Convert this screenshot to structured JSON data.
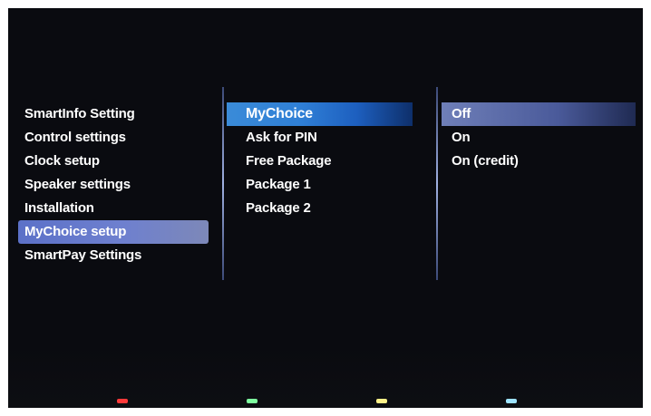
{
  "menu": {
    "categories": [
      {
        "label": "SmartInfo Setting",
        "selected": false
      },
      {
        "label": "Control settings",
        "selected": false
      },
      {
        "label": "Clock setup",
        "selected": false
      },
      {
        "label": "Speaker settings",
        "selected": false
      },
      {
        "label": "Installation",
        "selected": false
      },
      {
        "label": "MyChoice setup",
        "selected": true
      },
      {
        "label": "SmartPay Settings",
        "selected": false
      }
    ],
    "submenu": [
      {
        "label": "MyChoice",
        "selected": true
      },
      {
        "label": "Ask for PIN",
        "selected": false
      },
      {
        "label": "Free Package",
        "selected": false
      },
      {
        "label": "Package 1",
        "selected": false
      },
      {
        "label": "Package 2",
        "selected": false
      }
    ],
    "options": [
      {
        "label": "Off",
        "selected": true
      },
      {
        "label": "On",
        "selected": false
      },
      {
        "label": "On (credit)",
        "selected": false
      }
    ]
  },
  "color_keys": [
    {
      "name": "red",
      "color": "#ff3a3a"
    },
    {
      "name": "green",
      "color": "#7fffa0"
    },
    {
      "name": "yellow",
      "color": "#fff28a"
    },
    {
      "name": "blue",
      "color": "#9ee3ff"
    }
  ]
}
